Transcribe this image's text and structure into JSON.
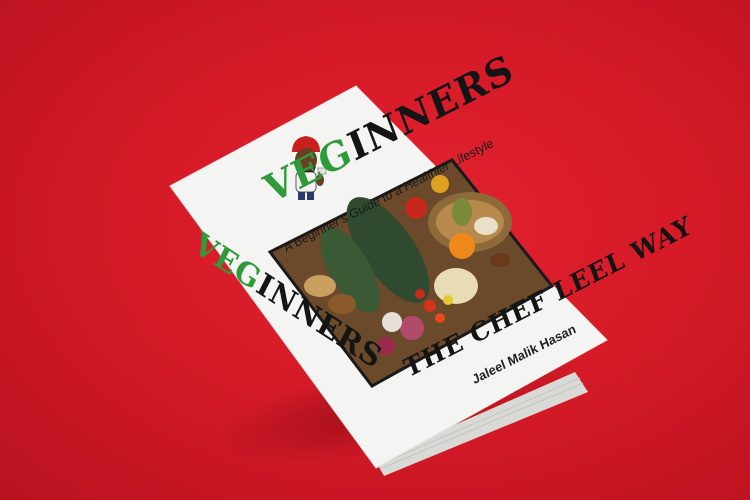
{
  "scene": {
    "background_color": "#d61a28",
    "book": {
      "title_green": "VEG",
      "title_black": "INNERS",
      "subtitle": "A Beginner's Guide to a Healthier Lifestyle",
      "tagline": "THE CHEF LEEL WAY",
      "author": "Jaleel Malik Hasan",
      "spine_title_green": "VEG",
      "spine_title_black": "INNERS",
      "colors": {
        "green": "#2e9a3a",
        "black": "#141414",
        "cover": "#f4f4f2"
      },
      "icons": [
        "chef-cartoon-icon",
        "vegetables-photo"
      ]
    }
  }
}
